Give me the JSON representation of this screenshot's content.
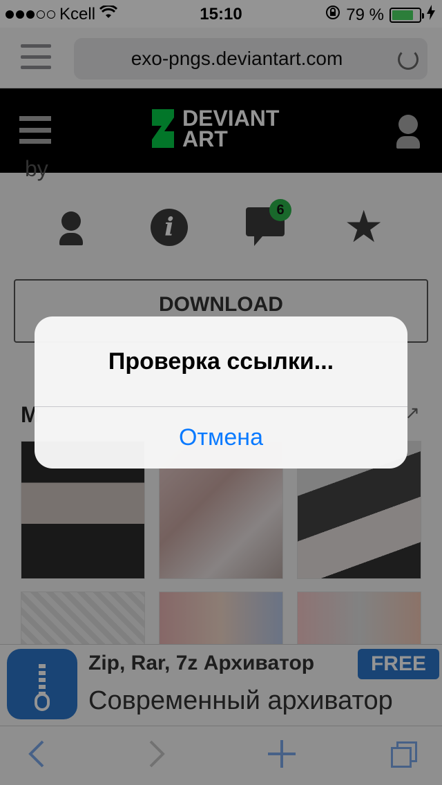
{
  "status_bar": {
    "carrier": "Kcell",
    "time": "15:10",
    "battery": "79 %",
    "battery_level": 0.79
  },
  "browser": {
    "url": "exo-pngs.deviantart.com"
  },
  "site": {
    "logo_text_line1": "DEVIANT",
    "logo_text_line2": "ART",
    "by_text": "by",
    "comments_badge": "6",
    "download_label": "DOWNLOAD",
    "more_title": "M"
  },
  "ad": {
    "title": "Zip, Rar, 7z Архиватор",
    "badge": "FREE",
    "subtitle": "Современный архиватор"
  },
  "alert": {
    "message": "Проверка ссылки...",
    "cancel": "Отмена"
  },
  "colors": {
    "accent": "#0a7aff",
    "deviantart_green": "#05cc47",
    "badge_green": "#2bb34b",
    "ad_blue": "#2b76ca"
  },
  "icons": [
    "wifi-icon",
    "lock-rotation-icon",
    "battery-icon",
    "charging-icon",
    "reader-menu-icon",
    "reload-icon",
    "hamburger-icon",
    "deviantart-logo-icon",
    "user-icon",
    "info-icon",
    "chat-icon",
    "star-icon",
    "back-icon",
    "forward-icon",
    "add-icon",
    "tabs-icon"
  ]
}
